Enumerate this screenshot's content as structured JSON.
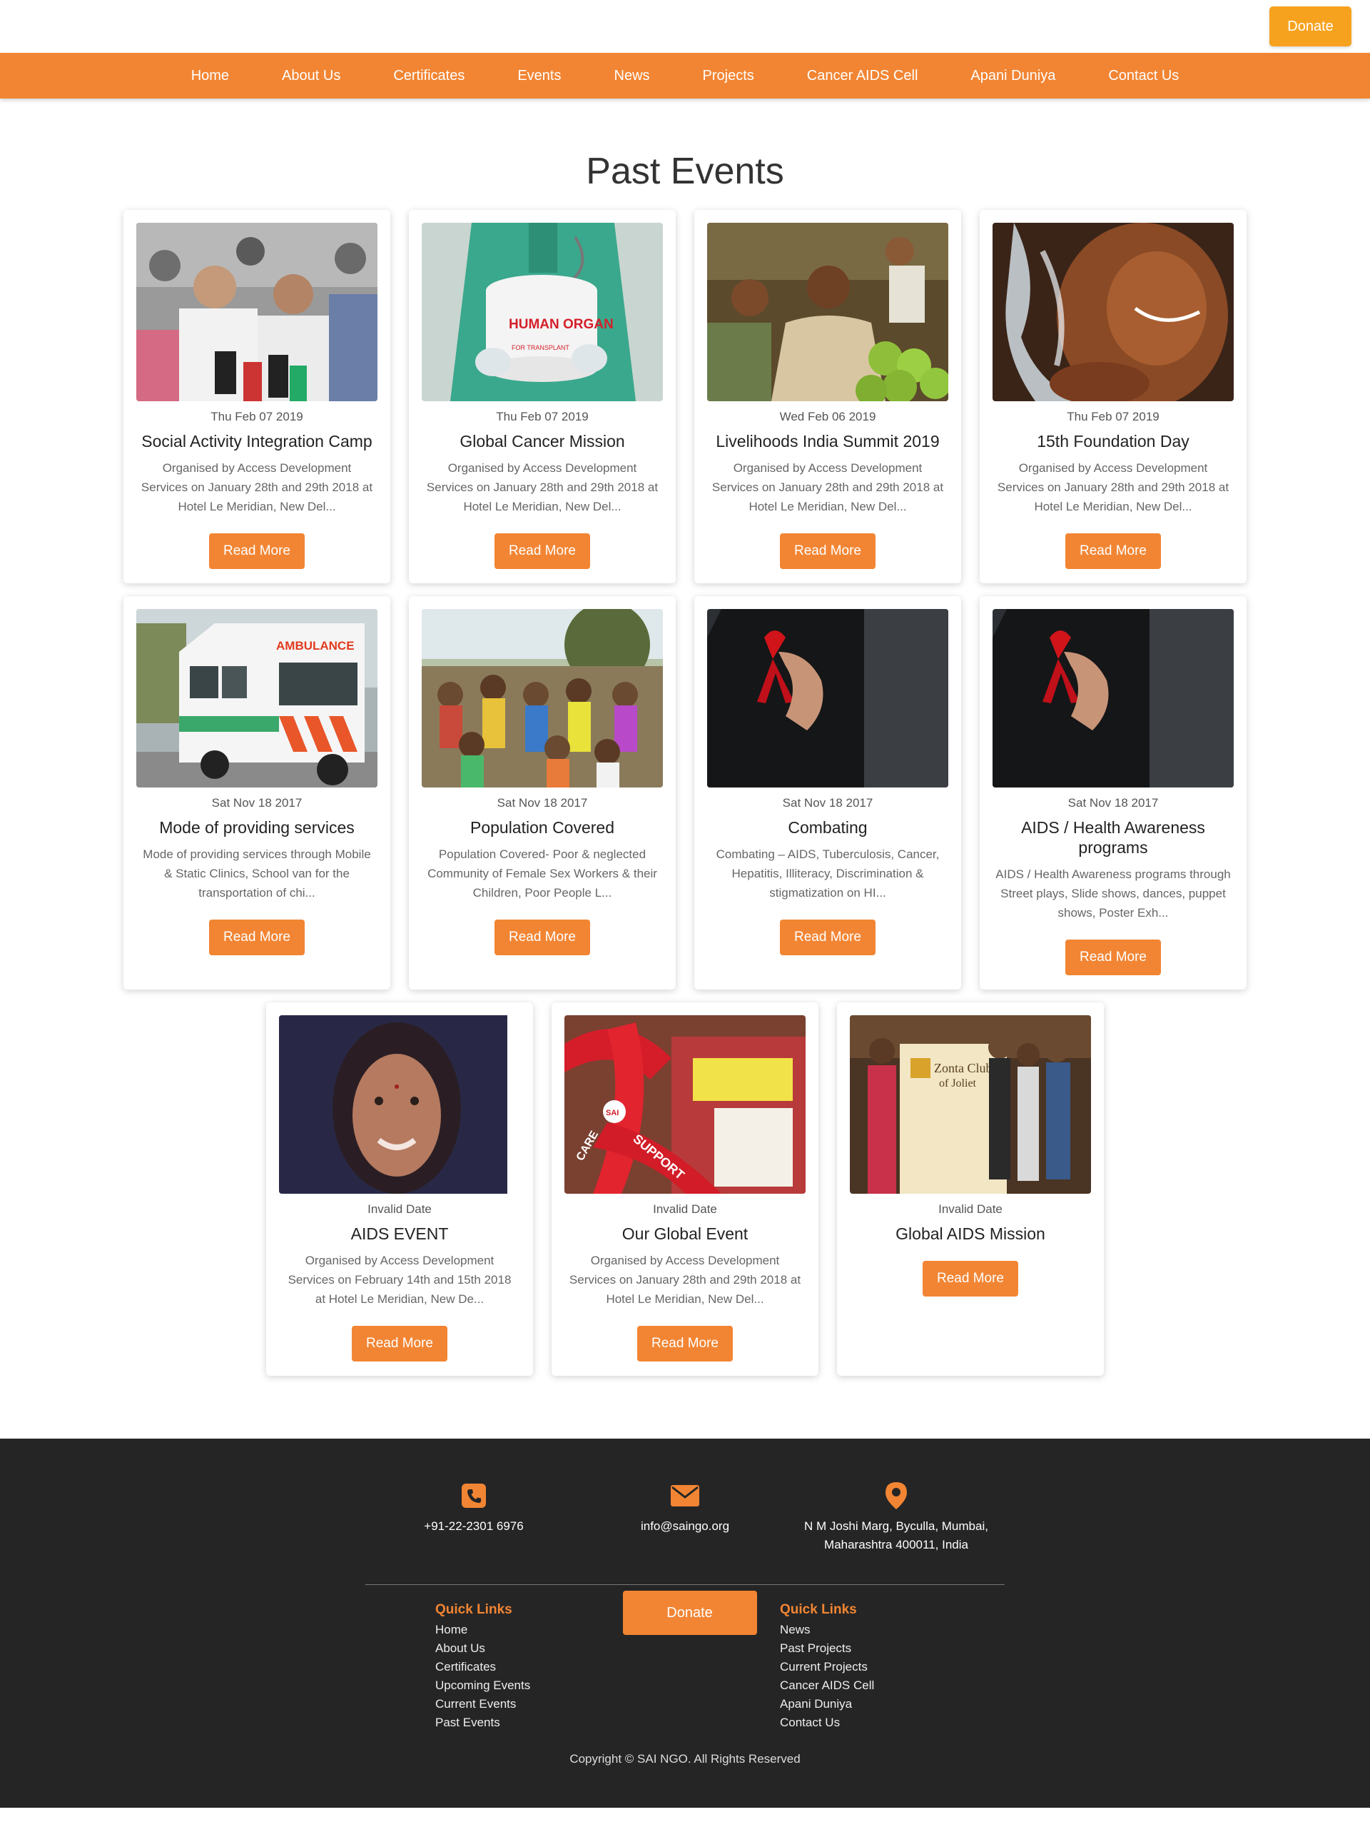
{
  "header": {
    "donate_label": "Donate"
  },
  "nav": {
    "items": [
      "Home",
      "About Us",
      "Certificates",
      "Events",
      "News",
      "Projects",
      "Cancer AIDS Cell",
      "Apani Duniya",
      "Contact Us"
    ]
  },
  "page_title": "Past Events",
  "read_more_label": "Read More",
  "events": [
    {
      "date": "Thu Feb 07 2019",
      "title": "Social Activity Integration Camp",
      "desc": "Organised by Access Development Services on January 28th and 29th 2018 at Hotel Le Meridian, New Del..."
    },
    {
      "date": "Thu Feb 07 2019",
      "title": "Global Cancer Mission",
      "desc": "Organised by Access Development Services on January 28th and 29th 2018 at Hotel Le Meridian, New Del..."
    },
    {
      "date": "Wed Feb 06 2019",
      "title": "Livelihoods India Summit 2019",
      "desc": "Organised by Access Development Services on January 28th and 29th 2018 at Hotel Le Meridian, New Del..."
    },
    {
      "date": "Thu Feb 07 2019",
      "title": "15th Foundation Day",
      "desc": "Organised by Access Development Services on January 28th and 29th 2018 at Hotel Le Meridian, New Del..."
    },
    {
      "date": "Sat Nov 18 2017",
      "title": "Mode of providing services",
      "desc": "Mode of providing services through Mobile & Static Clinics, School van for the transportation of chi..."
    },
    {
      "date": "Sat Nov 18 2017",
      "title": "Population Covered",
      "desc": "Population Covered- Poor & neglected Community of Female Sex Workers & their Children, Poor People L..."
    },
    {
      "date": "Sat Nov 18 2017",
      "title": "Combating",
      "desc": "Combating – AIDS, Tuberculosis, Cancer, Hepatitis, Illiteracy, Discrimination & stigmatization on HI..."
    },
    {
      "date": "Sat Nov 18 2017",
      "title": "AIDS / Health Awareness programs",
      "desc": "AIDS / Health Awareness programs through Street plays, Slide shows, dances, puppet shows, Poster Exh..."
    },
    {
      "date": "Invalid Date",
      "title": "AIDS EVENT",
      "desc": "Organised by Access Development Services on February 14th and 15th 2018 at Hotel Le Meridian, New De..."
    },
    {
      "date": "Invalid Date",
      "title": "Our Global Event",
      "desc": "Organised by Access Development Services on January 28th and 29th 2018 at Hotel Le Meridian, New Del..."
    },
    {
      "date": "Invalid Date",
      "title": "Global AIDS Mission",
      "desc": ""
    }
  ],
  "image_text": {
    "organ": "HUMAN ORGAN",
    "organ_sub": "FOR TRANSPLANT",
    "ambulance": "AMBULANCE",
    "support": "SUPPORT",
    "care": "CARE",
    "sai": "SAI",
    "zonta1": "Zonta Club",
    "zonta2": "of Joliet"
  },
  "footer": {
    "phone": "+91-22-2301 6976",
    "email": "info@saingo.org",
    "address_line1": "N M Joshi Marg, Byculla, Mumbai,",
    "address_line2": "Maharashtra 400011, India",
    "left_head": "Quick Links",
    "left_links": [
      "Home",
      "About Us",
      "Certificates",
      "Upcoming Events",
      "Current Events",
      "Past Events"
    ],
    "donate_label": "Donate",
    "right_head": "Quick Links",
    "right_links": [
      "News",
      "Past Projects",
      "Current Projects",
      "Cancer AIDS Cell",
      "Apani Duniya",
      "Contact Us"
    ],
    "copyright": "Copyright © SAI NGO. All Rights Reserved"
  },
  "colors": {
    "accent": "#f28533",
    "donate_top": "#f7a21e",
    "footer_bg": "#252525"
  }
}
